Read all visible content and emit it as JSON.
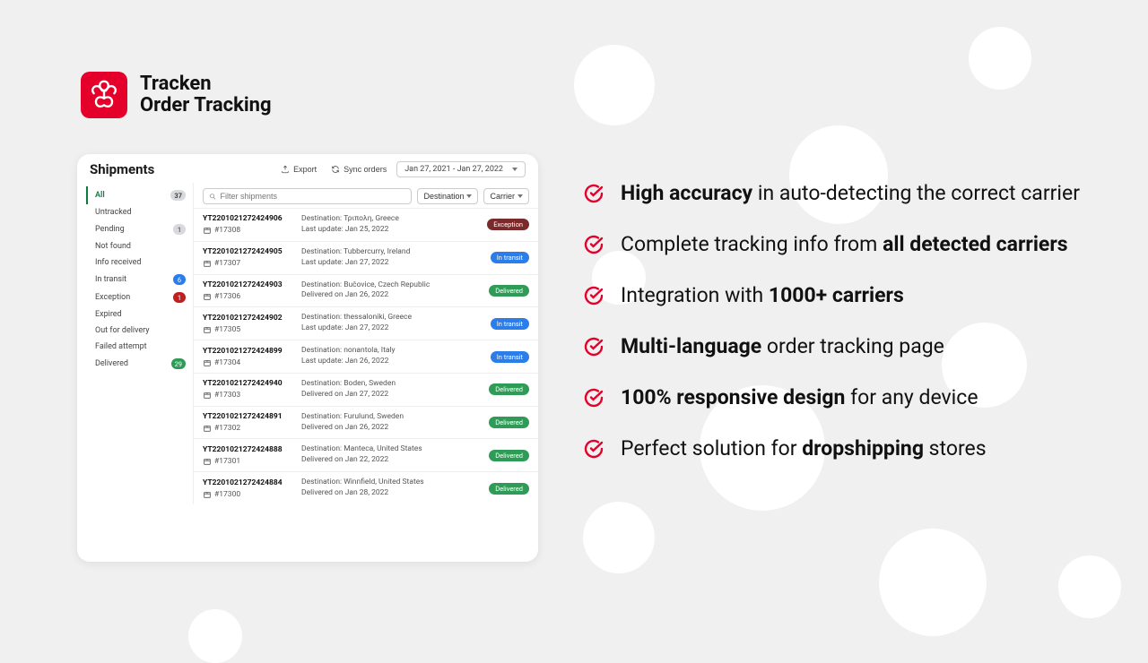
{
  "brand": {
    "line1": "Tracken",
    "line2": "Order Tracking"
  },
  "toolbar": {
    "title": "Shipments",
    "export": "Export",
    "sync": "Sync orders",
    "date_range": "Jan 27, 2021 - Jan 27, 2022"
  },
  "sidebar": {
    "items": [
      {
        "label": "All",
        "count": "37",
        "badge": "grey",
        "active": true
      },
      {
        "label": "Untracked"
      },
      {
        "label": "Pending",
        "count": "1",
        "badge": "grey"
      },
      {
        "label": "Not found"
      },
      {
        "label": "Info received"
      },
      {
        "label": "In transit",
        "count": "6",
        "badge": "blue"
      },
      {
        "label": "Exception",
        "count": "1",
        "badge": "red"
      },
      {
        "label": "Expired"
      },
      {
        "label": "Out for delivery"
      },
      {
        "label": "Failed attempt"
      },
      {
        "label": "Delivered",
        "count": "29",
        "badge": "green"
      }
    ]
  },
  "filters": {
    "placeholder": "Filter shipments",
    "destination": "Destination",
    "carrier": "Carrier"
  },
  "shipments": [
    {
      "track": "YT2201021272424906",
      "order": "#17308",
      "dest": "Destination: Τριπολη, Greece",
      "upd": "Last update: Jan 25, 2022",
      "status": "Exception",
      "pill": "exception"
    },
    {
      "track": "YT2201021272424905",
      "order": "#17307",
      "dest": "Destination: Tubbercurry, Ireland",
      "upd": "Last update: Jan 27, 2022",
      "status": "In transit",
      "pill": "intransit"
    },
    {
      "track": "YT2201021272424903",
      "order": "#17306",
      "dest": "Destination: Bučovice, Czech Republic",
      "upd": "Delivered on Jan 26, 2022",
      "status": "Delivered",
      "pill": "delivered"
    },
    {
      "track": "YT2201021272424902",
      "order": "#17305",
      "dest": "Destination: thessaloniki, Greece",
      "upd": "Last update: Jan 27, 2022",
      "status": "In transit",
      "pill": "intransit"
    },
    {
      "track": "YT2201021272424899",
      "order": "#17304",
      "dest": "Destination: nonantola, Italy",
      "upd": "Last update: Jan 26, 2022",
      "status": "In transit",
      "pill": "intransit"
    },
    {
      "track": "YT2201021272424940",
      "order": "#17303",
      "dest": "Destination: Boden, Sweden",
      "upd": "Delivered on Jan 27, 2022",
      "status": "Delivered",
      "pill": "delivered"
    },
    {
      "track": "YT2201021272424891",
      "order": "#17302",
      "dest": "Destination: Furulund, Sweden",
      "upd": "Delivered on Jan 26, 2022",
      "status": "Delivered",
      "pill": "delivered"
    },
    {
      "track": "YT2201021272424888",
      "order": "#17301",
      "dest": "Destination: Manteca, United States",
      "upd": "Delivered on Jan 22, 2022",
      "status": "Delivered",
      "pill": "delivered"
    },
    {
      "track": "YT2201021272424884",
      "order": "#17300",
      "dest": "Destination: Winnfield, United States",
      "upd": "Delivered on Jan 28, 2022",
      "status": "Delivered",
      "pill": "delivered"
    }
  ],
  "features": [
    {
      "html": "<b>High accuracy</b> in auto-detecting the correct carrier"
    },
    {
      "html": "Complete tracking info from <b>all detected carriers</b>"
    },
    {
      "html": "Integration with <b>1000+ carriers</b>"
    },
    {
      "html": "<b>Multi-language</b> order tracking page"
    },
    {
      "html": "<b>100% responsive design</b> for any device"
    },
    {
      "html": "Perfect solution for <b>dropshipping</b> stores"
    }
  ]
}
